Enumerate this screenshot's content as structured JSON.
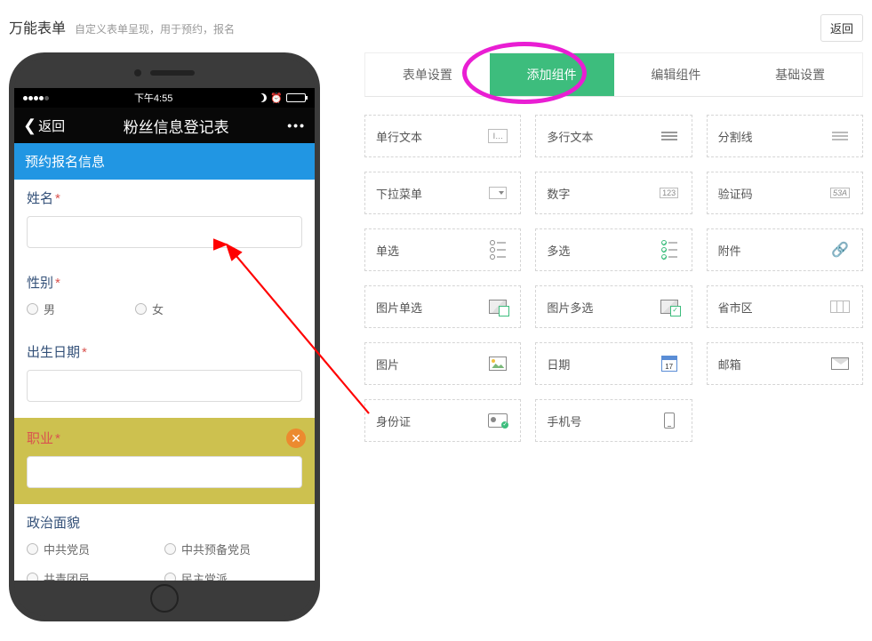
{
  "header": {
    "title": "万能表单",
    "subtitle": "自定义表单呈现，用于预约，报名",
    "back_btn": "返回"
  },
  "phone": {
    "statusbar": {
      "time": "下午4:55"
    },
    "nav": {
      "back": "返回",
      "title": "粉丝信息登记表",
      "more": "•••"
    },
    "section_title": "预约报名信息",
    "fields": {
      "name_label": "姓名",
      "gender_label": "性别",
      "gender_options": {
        "male": "男",
        "female": "女"
      },
      "dob_label": "出生日期",
      "job_label": "职业",
      "political_label": "政治面貌",
      "political_options": {
        "a": "中共党员",
        "b": "中共预备党员",
        "c": "共青团员",
        "d": "民主党派"
      }
    }
  },
  "tabs": {
    "form_settings": "表单设置",
    "add_component": "添加组件",
    "edit_component": "编辑组件",
    "basic_settings": "基础设置"
  },
  "components": {
    "single_text": "单行文本",
    "multi_text": "多行文本",
    "divider": "分割线",
    "dropdown": "下拉菜单",
    "number": "数字",
    "captcha": "验证码",
    "radio": "单选",
    "checkbox": "多选",
    "attachment": "附件",
    "image_radio": "图片单选",
    "image_checkbox": "图片多选",
    "region": "省市区",
    "image": "图片",
    "date": "日期",
    "email": "邮箱",
    "idcard": "身份证",
    "mobile": "手机号"
  },
  "icon_text": {
    "single_text": "I…",
    "number": "123",
    "captcha": "53A"
  }
}
